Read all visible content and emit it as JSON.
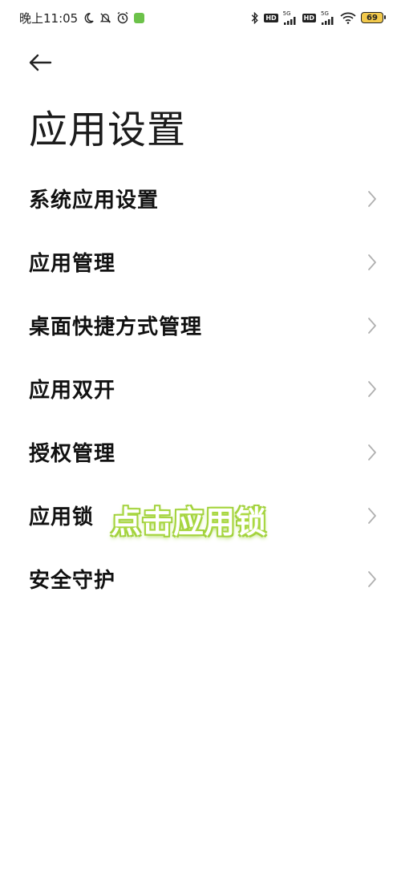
{
  "status_bar": {
    "time": "晚上11:05",
    "hd1": "HD",
    "net1": "5G",
    "hd2": "HD",
    "net2": "5G",
    "battery": "69"
  },
  "header": {
    "title": "应用设置"
  },
  "menu": {
    "items": [
      {
        "label": "系统应用设置"
      },
      {
        "label": "应用管理"
      },
      {
        "label": "桌面快捷方式管理"
      },
      {
        "label": "应用双开"
      },
      {
        "label": "授权管理"
      },
      {
        "label": "应用锁"
      },
      {
        "label": "安全守护"
      }
    ]
  },
  "annotation": {
    "text": "点击应用锁"
  },
  "colors": {
    "background": "#ffffff",
    "text": "#111111",
    "chevron": "#b0b0b0",
    "annotation_glow": "#9ccc3a"
  }
}
